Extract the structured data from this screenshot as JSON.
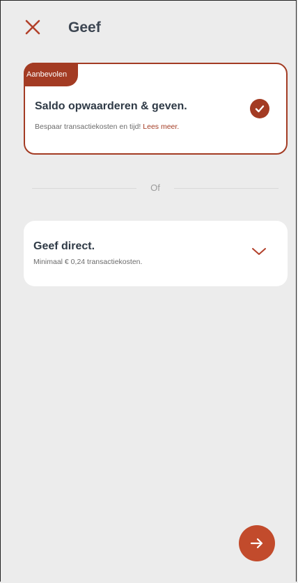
{
  "header": {
    "title": "Geef",
    "close_icon": "close-icon"
  },
  "options": {
    "recommended": {
      "badge": "Aanbevolen",
      "title": "Saldo opwaarderen & geven.",
      "subtitle": "Bespaar transactiekosten en tijd!",
      "link": "Lees meer.",
      "selected": true
    },
    "separator": "Of",
    "direct": {
      "title": "Geef direct.",
      "subtitle": "Minimaal € 0,24 transactiekosten.",
      "icon": "chevron-down-icon"
    }
  },
  "next_button": {
    "icon": "arrow-right-icon"
  },
  "colors": {
    "accent": "#a33b23",
    "button": "#c24b2c",
    "background": "#ececec",
    "card": "#ffffff"
  }
}
